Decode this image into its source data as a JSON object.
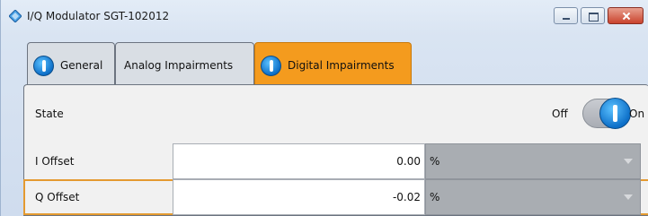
{
  "window": {
    "title": "I/Q Modulator SGT-102012",
    "title_icon": "rs-diamond-icon",
    "controls": [
      "minimize-icon",
      "maximize-icon",
      "close-icon"
    ]
  },
  "tabs": [
    {
      "label": "General",
      "icon": "info-icon",
      "active": false
    },
    {
      "label": "Analog Impairments",
      "active": false
    },
    {
      "label": "Digital Impairments",
      "icon": "info-icon",
      "active": true
    }
  ],
  "state": {
    "label": "State",
    "off_label": "Off",
    "on_label": "On",
    "value": "On"
  },
  "i_offset": {
    "label": "I Offset",
    "value": "0.00",
    "unit": "%"
  },
  "q_offset": {
    "label": "Q Offset",
    "value": "-0.02",
    "unit": "%"
  },
  "colors": {
    "active_tab": "#f49b1e",
    "focus_border": "#e49a30",
    "toggle_knob": "#0d6fc8"
  }
}
